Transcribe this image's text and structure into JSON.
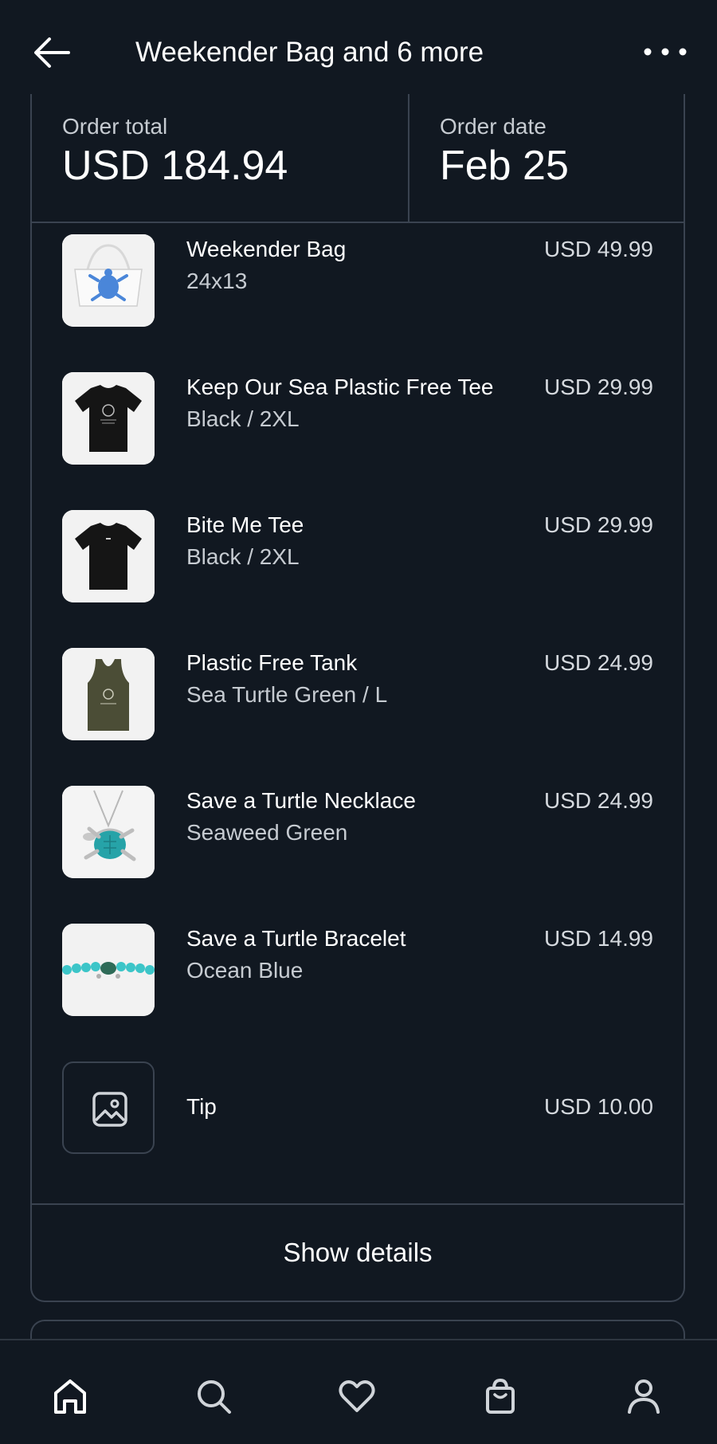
{
  "header": {
    "title": "Weekender Bag and 6 more"
  },
  "summary": {
    "total_label": "Order total",
    "total_value": "USD 184.94",
    "date_label": "Order date",
    "date_value": "Feb 25"
  },
  "items": [
    {
      "name": "Weekender Bag",
      "variant": "24x13",
      "price": "USD 49.99",
      "icon": "weekender-bag-image"
    },
    {
      "name": "Keep Our Sea Plastic Free Tee",
      "variant": "Black / 2XL",
      "price": "USD 29.99",
      "icon": "black-tee-image"
    },
    {
      "name": "Bite Me Tee",
      "variant": "Black / 2XL",
      "price": "USD 29.99",
      "icon": "black-tee-image"
    },
    {
      "name": "Plastic Free Tank",
      "variant": "Sea Turtle Green / L",
      "price": "USD 24.99",
      "icon": "green-tank-image"
    },
    {
      "name": "Save a Turtle Necklace",
      "variant": "Seaweed Green",
      "price": "USD 24.99",
      "icon": "turtle-necklace-image"
    },
    {
      "name": "Save a Turtle Bracelet",
      "variant": "Ocean Blue",
      "price": "USD 14.99",
      "icon": "bracelet-image"
    },
    {
      "name": "Tip",
      "variant": "",
      "price": "USD 10.00",
      "icon": "image-placeholder-icon"
    }
  ],
  "actions": {
    "show_details": "Show details"
  },
  "nav": [
    "home-icon",
    "search-icon",
    "heart-icon",
    "shopping-bag-icon",
    "profile-icon"
  ],
  "colors": {
    "background": "#111821",
    "border": "#3a4350",
    "text": "#ffffff",
    "muted_text": "#c6cbd1"
  }
}
